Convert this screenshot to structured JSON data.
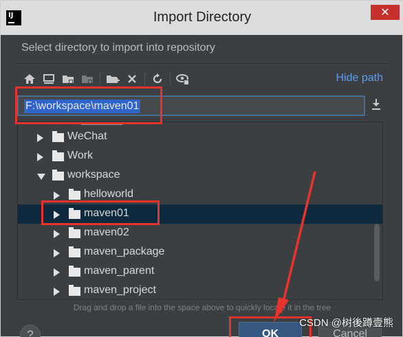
{
  "window": {
    "app_icon_text": "IJ",
    "title": "Import Directory",
    "close_glyph": "✕"
  },
  "description": "Select directory to import into repository",
  "toolbar": {
    "icons": [
      "home-icon",
      "desktop-icon",
      "project-folder-icon",
      "module-folder-icon",
      "new-folder-icon",
      "delete-icon",
      "refresh-icon",
      "show-hidden-icon"
    ],
    "hide_path_label": "Hide path"
  },
  "path_field": {
    "value": "F:\\workspace\\maven01",
    "download_icon": "download-icon"
  },
  "tree": {
    "items": [
      {
        "label": "WeChat",
        "expanded": false,
        "selected": false
      },
      {
        "label": "Work",
        "expanded": false,
        "selected": false
      },
      {
        "label": "workspace",
        "expanded": true,
        "selected": false
      },
      {
        "label": "helloworld",
        "expanded": false,
        "selected": false
      },
      {
        "label": "maven01",
        "expanded": false,
        "selected": true
      },
      {
        "label": "maven02",
        "expanded": false,
        "selected": false
      },
      {
        "label": "maven_package",
        "expanded": false,
        "selected": false
      },
      {
        "label": "maven_parent",
        "expanded": false,
        "selected": false
      },
      {
        "label": "maven_project",
        "expanded": false,
        "selected": false
      }
    ]
  },
  "hint": "Drag and drop a file into the space above to quickly locate it in the tree",
  "buttons": {
    "help": "?",
    "ok": "OK",
    "cancel": "Cancel"
  },
  "watermark": "CSDN @树後蹲壹熊",
  "colors": {
    "dialog_bg": "#3c3f41",
    "selection": "#0d293e",
    "path_selection": "#2f65ca",
    "link": "#589df6",
    "annotation": "#e8322c"
  }
}
